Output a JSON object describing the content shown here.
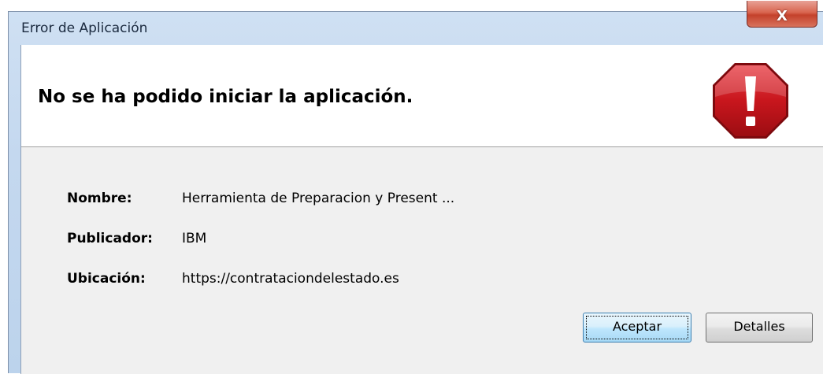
{
  "window": {
    "title": "Error de Aplicación",
    "close_glyph": "X"
  },
  "header": {
    "message": "No se ha podido iniciar la aplicación.",
    "icon": "stop-error-icon",
    "icon_color": "#c8161d"
  },
  "details": [
    {
      "label": "Nombre:",
      "value": "Herramienta de Preparacion y Present ..."
    },
    {
      "label": "Publicador:",
      "value": "IBM"
    },
    {
      "label": "Ubicación:",
      "value": "https://contrataciondelestado.es"
    }
  ],
  "buttons": {
    "accept_label": "Aceptar",
    "details_label": "Detalles"
  }
}
